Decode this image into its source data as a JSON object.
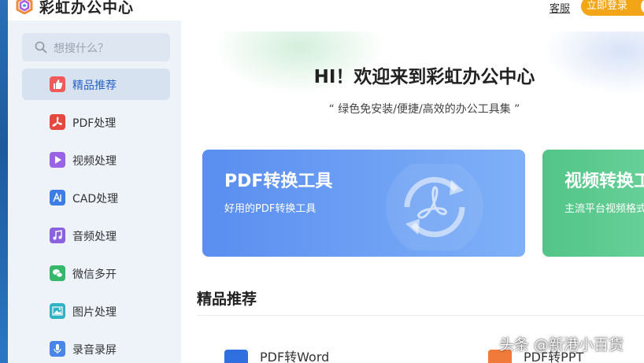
{
  "header": {
    "app_title": "彩虹办公中心",
    "help_link": "客服",
    "login_label": "立即登录"
  },
  "sidebar": {
    "search_placeholder": "想搜什么？",
    "items": [
      {
        "label": "精品推荐",
        "icon": "thumbs-up-icon",
        "color": "#f05a5a",
        "active": true
      },
      {
        "label": "PDF处理",
        "icon": "pdf-icon",
        "color": "#e5483f",
        "active": false
      },
      {
        "label": "视频处理",
        "icon": "video-play-icon",
        "color": "#9a63e6",
        "active": false
      },
      {
        "label": "CAD处理",
        "icon": "cad-icon",
        "color": "#3d7ee6",
        "active": false
      },
      {
        "label": "音频处理",
        "icon": "music-icon",
        "color": "#8a62e0",
        "active": false
      },
      {
        "label": "微信多开",
        "icon": "wechat-icon",
        "color": "#36b86a",
        "active": false
      },
      {
        "label": "图片处理",
        "icon": "image-icon",
        "color": "#2fb2c4",
        "active": false
      },
      {
        "label": "录音录屏",
        "icon": "microphone-icon",
        "color": "#4a86ea",
        "active": false
      }
    ]
  },
  "hero": {
    "title": "HI！欢迎来到彩虹办公中心",
    "subtitle": "“ 绿色免安装/便捷/高效的办公工具集 ”"
  },
  "cards": [
    {
      "title": "PDF转换工具",
      "desc": "好用的PDF转换工具",
      "color": "#5a8ef0"
    },
    {
      "title": "视频转换工",
      "desc": "主流平台视频格式",
      "color": "#53c487"
    }
  ],
  "section": {
    "title": "精品推荐"
  },
  "tools": [
    {
      "label": "PDF转Word",
      "color": "#2f6fe0"
    },
    {
      "label": "PDF转PPT",
      "color": "#f07a3a"
    }
  ],
  "watermark": "头条 @新港小百货",
  "colors": {
    "accent": "#2a62c9",
    "login": "#f2a516",
    "sidebar_bg": "#eef3fa"
  }
}
